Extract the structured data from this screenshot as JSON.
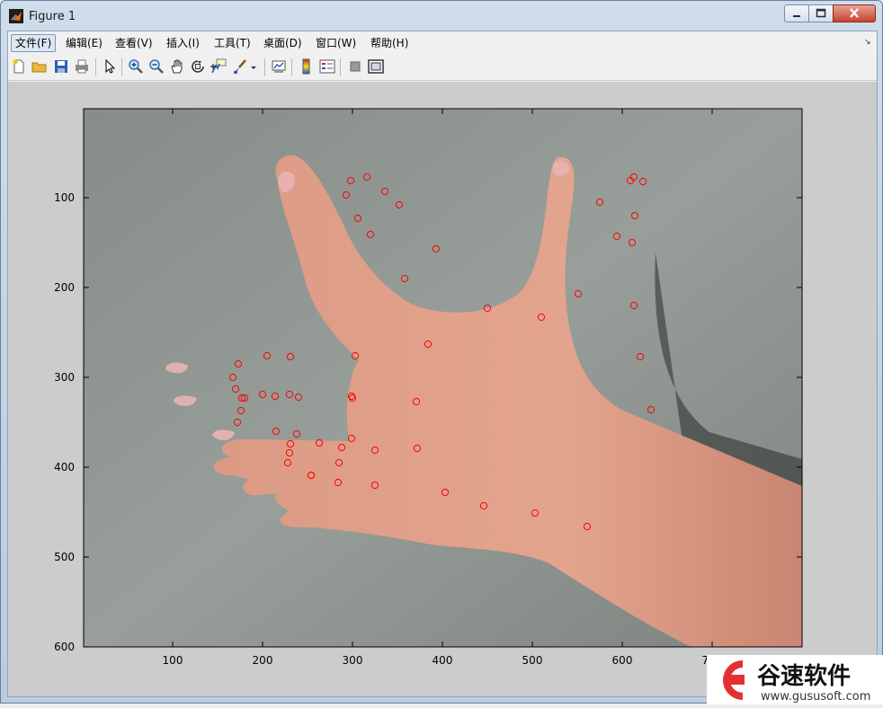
{
  "window": {
    "title": "Figure 1"
  },
  "menus": [
    {
      "label": "文件(F)"
    },
    {
      "label": "编辑(E)"
    },
    {
      "label": "查看(V)"
    },
    {
      "label": "插入(I)"
    },
    {
      "label": "工具(T)"
    },
    {
      "label": "桌面(D)"
    },
    {
      "label": "窗口(W)"
    },
    {
      "label": "帮助(H)"
    }
  ],
  "toolbar": {
    "icons": [
      "new-figure-icon",
      "open-file-icon",
      "save-icon",
      "print-icon",
      "edit-plot-arrow-icon",
      "zoom-in-icon",
      "zoom-out-icon",
      "pan-hand-icon",
      "rotate-3d-icon",
      "data-cursor-icon",
      "brush-icon",
      "brush-dropdown-icon",
      "link-plot-icon",
      "colorbar-icon",
      "legend-icon",
      "hide-plot-tools-icon",
      "show-plot-tools-icon"
    ]
  },
  "axes": {
    "xlim": [
      1,
      800
    ],
    "ylim": [
      1,
      600
    ],
    "ydir": "reverse",
    "xticks": [
      100,
      200,
      300,
      400,
      500,
      600,
      700
    ],
    "xtick_labels": [
      "100",
      "200",
      "300",
      "400",
      "500",
      "600",
      "700"
    ],
    "yticks": [
      100,
      200,
      300,
      400,
      500,
      600
    ],
    "ytick_labels": [
      "100",
      "200",
      "300",
      "400",
      "500",
      "600"
    ],
    "marker": "circle",
    "marker_color": "#ff0000",
    "grid": "off",
    "image_content": "photograph of a left hand on a grey background"
  },
  "chart_data": {
    "type": "scatter",
    "series": [
      {
        "marker_color": "#ff0000",
        "x": [
          316,
          298,
          293,
          306,
          320,
          336,
          352,
          358,
          393,
          384,
          450,
          510,
          551,
          575,
          594,
          609,
          613,
          623,
          614,
          611,
          613,
          620,
          632,
          173,
          167,
          170,
          205,
          231,
          303,
          180,
          176,
          172,
          177,
          200,
          214,
          230,
          240,
          299,
          300,
          371,
          215,
          238,
          231,
          230,
          263,
          299,
          325,
          372,
          288,
          284,
          285,
          254,
          228,
          254,
          325,
          403,
          446,
          503,
          561
        ],
        "y": [
          77,
          81,
          97,
          123,
          141,
          93,
          108,
          190,
          157,
          263,
          223,
          233,
          207,
          105,
          143,
          81,
          77,
          82,
          120,
          150,
          220,
          277,
          336,
          285,
          300,
          313,
          276,
          277,
          276,
          323,
          337,
          350,
          323,
          319,
          321,
          319,
          322,
          321,
          323,
          327,
          360,
          363,
          374,
          384,
          373,
          368,
          381,
          379,
          378,
          417,
          395,
          409,
          395,
          409,
          420,
          428,
          443,
          451,
          466
        ]
      }
    ]
  }
}
